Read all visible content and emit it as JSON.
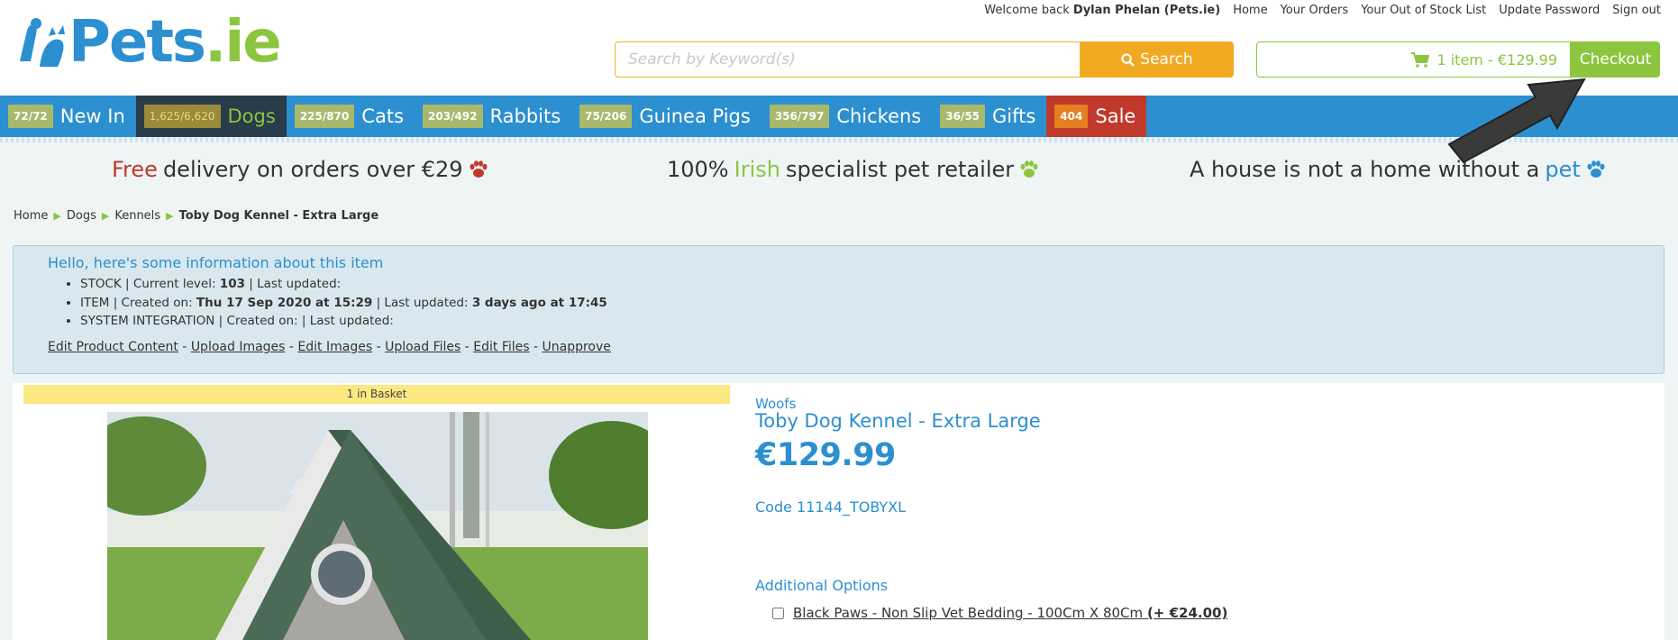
{
  "header": {
    "logo_text_main": "Pets",
    "logo_text_tld": ".ie",
    "top_links": {
      "welcome_prefix": "Welcome back",
      "welcome_user": "Dylan Phelan (Pets.ie)",
      "home": "Home",
      "orders": "Your Orders",
      "out_of_stock": "Your Out of Stock List",
      "update_password": "Update Password",
      "sign_out": "Sign out"
    },
    "search": {
      "placeholder": "Search by Keyword(s)",
      "button_label": "Search"
    },
    "cart": {
      "summary": "1 item - €129.99",
      "checkout_label": "Checkout"
    }
  },
  "categories": [
    {
      "badge": "72/72",
      "label": "New In"
    },
    {
      "badge": "1,625/6,620",
      "label": "Dogs"
    },
    {
      "badge": "225/870",
      "label": "Cats"
    },
    {
      "badge": "203/492",
      "label": "Rabbits"
    },
    {
      "badge": "75/206",
      "label": "Guinea Pigs"
    },
    {
      "badge": "356/797",
      "label": "Chickens"
    },
    {
      "badge": "36/55",
      "label": "Gifts"
    },
    {
      "badge": "404",
      "label": "Sale"
    }
  ],
  "usps": {
    "one_highlight": "Free",
    "one_rest": "delivery on orders over €29",
    "two_prefix": "100%",
    "two_highlight": "Irish",
    "two_rest": "specialist pet retailer",
    "three_prefix": "A house is not a home without a",
    "three_highlight": "pet"
  },
  "breadcrumb": {
    "home": "Home",
    "dogs": "Dogs",
    "kennels": "Kennels",
    "current": "Toby Dog Kennel - Extra Large"
  },
  "info_panel": {
    "heading": "Hello, here's some information about this item",
    "stock_prefix": "STOCK | Current level:",
    "stock_level": "103",
    "stock_suffix": "| Last updated:",
    "item_prefix": "ITEM | Created on:",
    "item_created": "Thu 17 Sep 2020 at 15:29",
    "item_mid": "| Last updated:",
    "item_updated": "3 days ago at 17:45",
    "system_line": "SYSTEM INTEGRATION | Created on: | Last updated:",
    "links": {
      "edit_content": "Edit Product Content",
      "upload_images": "Upload Images",
      "edit_images": "Edit Images",
      "upload_files": "Upload Files",
      "edit_files": "Edit Files",
      "unapprove": "Unapprove"
    }
  },
  "product": {
    "basket_banner": "1 in Basket",
    "brand": "Woofs",
    "title": "Toby Dog Kennel - Extra Large",
    "price": "€129.99",
    "code": "Code 11144_TOBYXL",
    "additional_options_label": "Additional Options",
    "option_label": "Black Paws - Non Slip Vet Bedding - 100Cm X 80Cm",
    "option_price": "(+ €24.00)",
    "option_checked": false
  },
  "colors": {
    "brand_blue": "#2b8fd0",
    "brand_green": "#8cc63f",
    "search_orange": "#f2a922",
    "sale_red": "#c0392b"
  }
}
